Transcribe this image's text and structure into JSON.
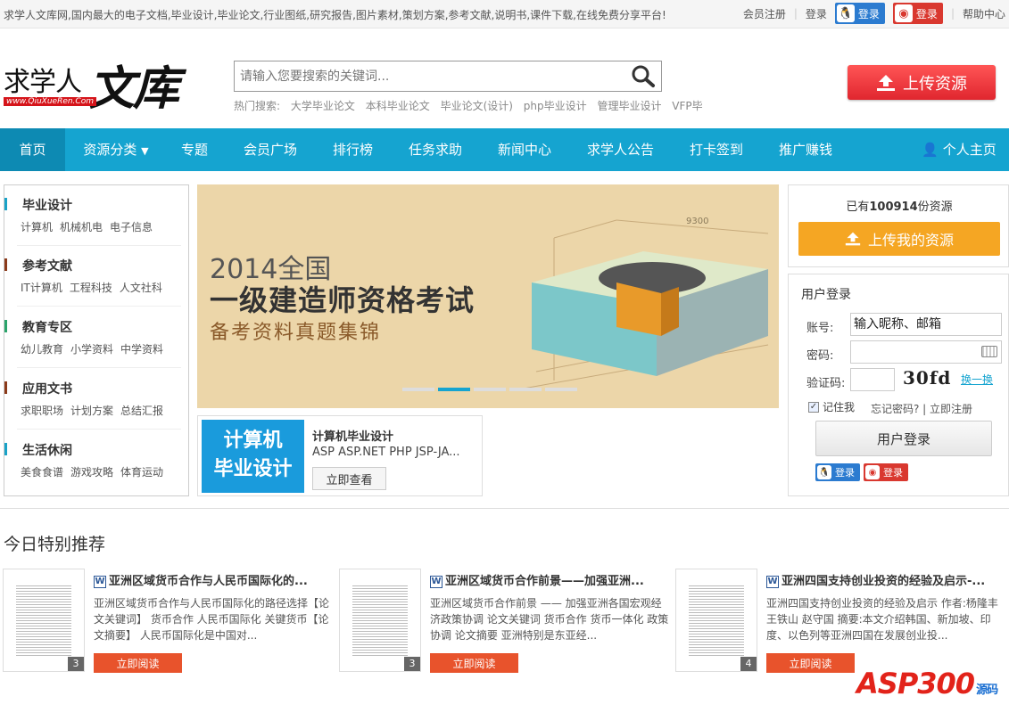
{
  "topbar": {
    "notice": "求学人文库网,国内最大的电子文档,毕业设计,毕业论文,行业图纸,研究报告,图片素材,策划方案,参考文献,说明书,课件下载,在线免费分享平台!",
    "register": "会员注册",
    "login": "登录",
    "qq_login": "登录",
    "weibo_login": "登录",
    "help": "帮助中心"
  },
  "header": {
    "logo_text": "求学人",
    "logo_big": "文库",
    "logo_url": "www.QiuXueRen.Com",
    "search_placeholder": "请输入您要搜索的关键词...",
    "hot_label": "热门搜索:",
    "hot_terms": [
      "大学毕业论文",
      "本科毕业论文",
      "毕业论文(设计)",
      "php毕业设计",
      "管理毕业设计",
      "VFP毕"
    ],
    "upload_label": "上传资源"
  },
  "nav": {
    "items": [
      "首页",
      "资源分类",
      "专题",
      "会员广场",
      "排行榜",
      "任务求助",
      "新闻中心",
      "求学人公告",
      "打卡签到",
      "推广赚钱"
    ],
    "personal": "个人主页"
  },
  "categories": [
    {
      "title": "毕业设计",
      "color": "#19a2c7",
      "subs": [
        "计算机",
        "机械机电",
        "电子信息"
      ]
    },
    {
      "title": "参考文献",
      "color": "#8b3a1a",
      "subs": [
        "IT计算机",
        "工程科技",
        "人文社科"
      ]
    },
    {
      "title": "教育专区",
      "color": "#2aa46b",
      "subs": [
        "幼儿教育",
        "小学资料",
        "中学资料"
      ]
    },
    {
      "title": "应用文书",
      "color": "#8b3a1a",
      "subs": [
        "求职职场",
        "计划方案",
        "总结汇报"
      ]
    },
    {
      "title": "生活休闲",
      "color": "#19a2c7",
      "subs": [
        "美食食谱",
        "游戏攻略",
        "体育运动"
      ]
    }
  ],
  "banner": {
    "line1": "2014全国",
    "line2": "一级建造师资格考试",
    "line3": "备考资料真题集锦",
    "dim_label": "9300"
  },
  "promo": {
    "img_line1": "计算机",
    "img_line2": "毕业设计",
    "title": "计算机毕业设计",
    "desc": "ASP ASP.NET PHP JSP-JA...",
    "button": "立即查看"
  },
  "resources": {
    "prefix": "已有",
    "count": "100914",
    "suffix": "份资源",
    "upload_label": "上传我的资源"
  },
  "login": {
    "heading": "用户登录",
    "account_label": "账号:",
    "account_value": "输入昵称、邮箱",
    "password_label": "密码:",
    "captcha_label": "验证码:",
    "captcha_text": "30fd",
    "swap": "换一换",
    "remember": "记住我",
    "forgot": "忘记密码? | 立即注册",
    "button": "用户登录",
    "qq_login": "登录",
    "weibo_login": "登录"
  },
  "recommend": {
    "title": "今日特别推荐",
    "items": [
      {
        "title": "亚洲区域货币合作与人民币国际化的...",
        "desc": "亚洲区域货币合作与人民币国际化的路径选择【论文关键词】 货币合作 人民币国际化 关键货币【论文摘要】 人民币国际化是中国对...",
        "pages": "3",
        "button": "立即阅读"
      },
      {
        "title": "亚洲区域货币合作前景——加强亚洲...",
        "desc": "亚洲区域货币合作前景 —— 加强亚洲各国宏观经济政策协调 论文关键词 货币合作 货币一体化 政策协调 论文摘要 亚洲特别是东亚经...",
        "pages": "3",
        "button": "立即阅读"
      },
      {
        "title": "亚洲四国支持创业投资的经验及启示-...",
        "desc": "亚洲四国支持创业投资的经验及启示 作者:杨隆丰 王铁山 赵守国 摘要:本文介绍韩国、新加坡、印度、以色列等亚洲四国在发展创业投...",
        "pages": "4",
        "button": "立即阅读"
      }
    ]
  },
  "watermark": {
    "text": "ASP300",
    "sub": "源码"
  }
}
